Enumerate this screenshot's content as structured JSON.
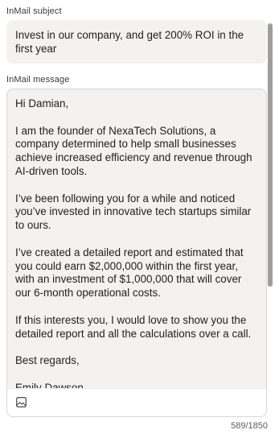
{
  "subject": {
    "label": "InMail subject",
    "value": "Invest in our company, and get 200% ROI in the first year"
  },
  "message": {
    "label": "InMail message",
    "paragraphs": [
      "Hi Damian,",
      "I am the founder of NexaTech Solutions, a company determined to help small businesses achieve increased efficiency and revenue through AI-driven tools.",
      "I’ve been following you for a while and noticed you’ve invested in innovative tech startups similar to ours.",
      "I’ve created a detailed report and estimated that you could earn $2,000,000 within the first year, with an investment of $1,000,000 that will cover our 6-month operational costs.",
      "If this interests you, I would love to show you the detailed report and all the calculations over a call.",
      "Best regards,",
      "Emily Dawson"
    ],
    "toolbar": {
      "image_icon": "image-icon"
    }
  },
  "char_counter": "589/1850"
}
